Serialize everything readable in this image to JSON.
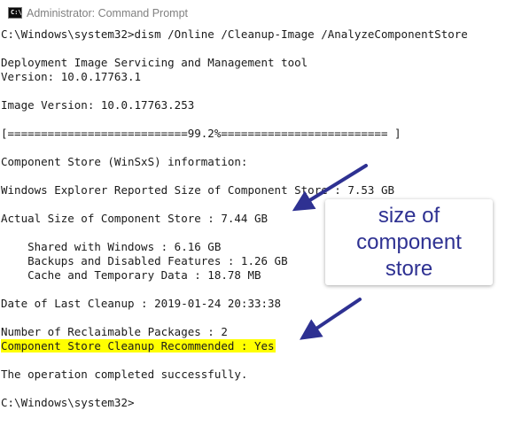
{
  "window": {
    "title": "Administrator: Command Prompt",
    "icon": "cmd-icon",
    "icon_glyph": "C:\\"
  },
  "console": {
    "lines": [
      "C:\\Windows\\system32>dism /Online /Cleanup-Image /AnalyzeComponentStore",
      "",
      "Deployment Image Servicing and Management tool",
      "Version: 10.0.17763.1",
      "",
      "Image Version: 10.0.17763.253",
      "",
      "[===========================99.2%========================= ]",
      "",
      "Component Store (WinSxS) information:",
      "",
      "Windows Explorer Reported Size of Component Store : 7.53 GB",
      "",
      "Actual Size of Component Store : 7.44 GB",
      "",
      "    Shared with Windows : 6.16 GB",
      "    Backups and Disabled Features : 1.26 GB",
      "    Cache and Temporary Data : 18.78 MB",
      "",
      "Date of Last Cleanup : 2019-01-24 20:33:38",
      "",
      "Number of Reclaimable Packages : 2",
      "Component Store Cleanup Recommended : Yes",
      "",
      "The operation completed successfully.",
      "",
      "C:\\Windows\\system32>"
    ]
  },
  "callout": {
    "text": "size of\ncomponent\nstore",
    "color": "#2e3192"
  },
  "colors": {
    "arrow": "#2e3192",
    "highlight": "#ffff00",
    "console_text": "#1a1a1a",
    "background": "#ffffff"
  }
}
